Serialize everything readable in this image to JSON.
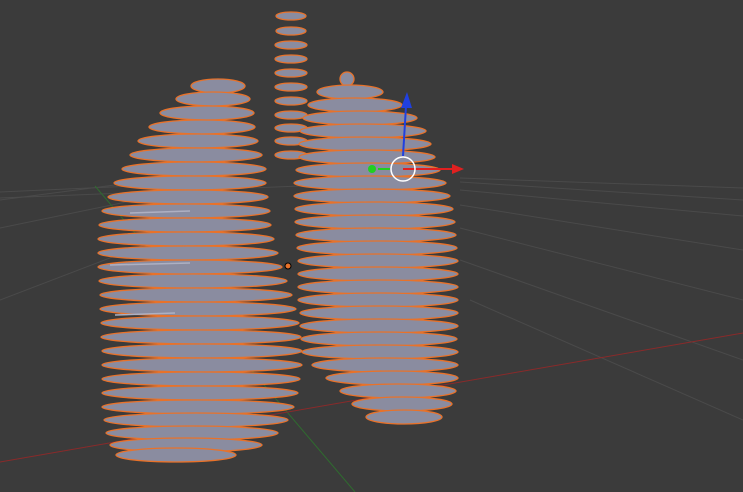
{
  "viewport": {
    "background": "#3b3b3b",
    "grid_color": "#4a4a4a",
    "x_axis_color": "#8a2a2a",
    "y_axis_color": "#2f6b2f",
    "selection_outline": "#e8722a",
    "mesh_fill": "#8a8ca0",
    "mesh_highlight": "#aeb0c2"
  },
  "gizmo": {
    "x_color": "#e02020",
    "y_color": "#20d020",
    "z_color": "#2040e0",
    "ring_color": "#ffffff",
    "origin_color": "#e8722a"
  },
  "icons": {
    "gizmo": "translate-gizmo-icon",
    "origin": "origin-point-icon"
  }
}
